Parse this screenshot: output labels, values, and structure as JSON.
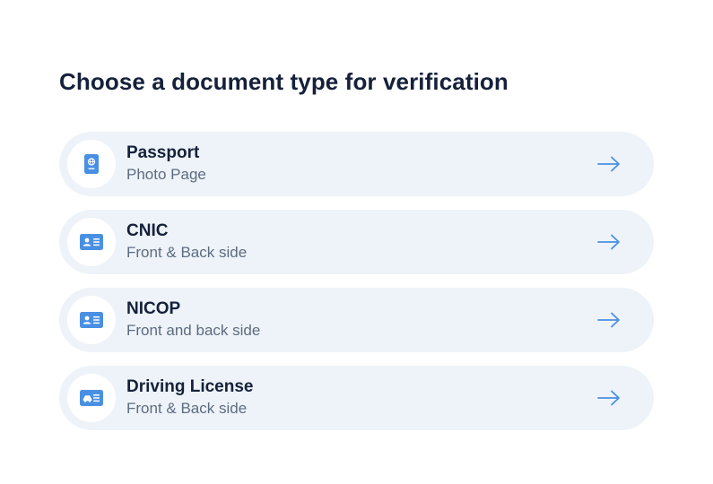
{
  "page": {
    "title": "Choose a document type for verification"
  },
  "documents": [
    {
      "title": "Passport",
      "subtitle": "Photo Page",
      "icon": "passport-icon"
    },
    {
      "title": "CNIC",
      "subtitle": "Front & Back side",
      "icon": "id-card-icon"
    },
    {
      "title": "NICOP",
      "subtitle": "Front and back side",
      "icon": "id-card-icon"
    },
    {
      "title": "Driving License",
      "subtitle": "Front & Back side",
      "icon": "driving-license-icon"
    }
  ],
  "colors": {
    "accent": "#4a90e2",
    "item_background": "#eef3f9",
    "title_text": "#15213a",
    "subtitle_text": "#5d6b80"
  }
}
